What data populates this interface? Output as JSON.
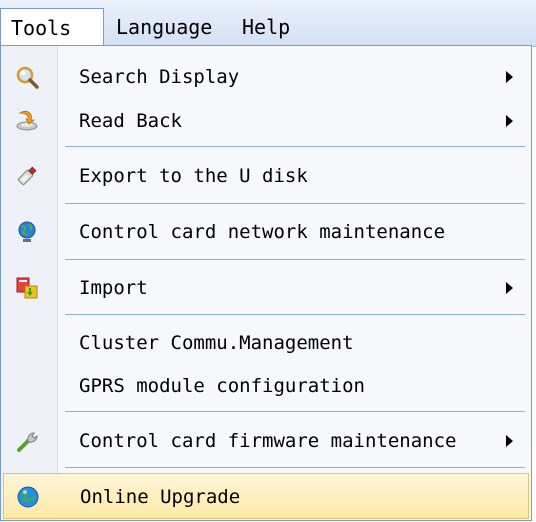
{
  "menubar": {
    "items": [
      "Tools",
      "Language",
      "Help"
    ],
    "active": "Tools"
  },
  "menu": {
    "items": [
      {
        "label": "Search Display",
        "icon": "magnifier-icon",
        "submenu": true
      },
      {
        "label": "Read Back",
        "icon": "read-back-icon",
        "submenu": true
      },
      {
        "label": "Export to the U disk",
        "icon": "usb-drive-icon",
        "submenu": false
      },
      {
        "label": "Control card network maintenance",
        "icon": "globe-network-icon",
        "submenu": false
      },
      {
        "label": "Import",
        "icon": "import-icon",
        "submenu": true
      },
      {
        "label": "Cluster Commu.Management",
        "icon": "",
        "submenu": false
      },
      {
        "label": "GPRS module configuration",
        "icon": "",
        "submenu": false
      },
      {
        "label": "Control card firmware maintenance",
        "icon": "wrench-icon",
        "submenu": true
      },
      {
        "label": "Online Upgrade",
        "icon": "globe-upgrade-icon",
        "submenu": false,
        "highlighted": true
      }
    ]
  },
  "colors": {
    "menubar_bg": "#d3e1f4",
    "highlight_bg": "#ffe8a8",
    "separator": "#8fb0dc"
  }
}
